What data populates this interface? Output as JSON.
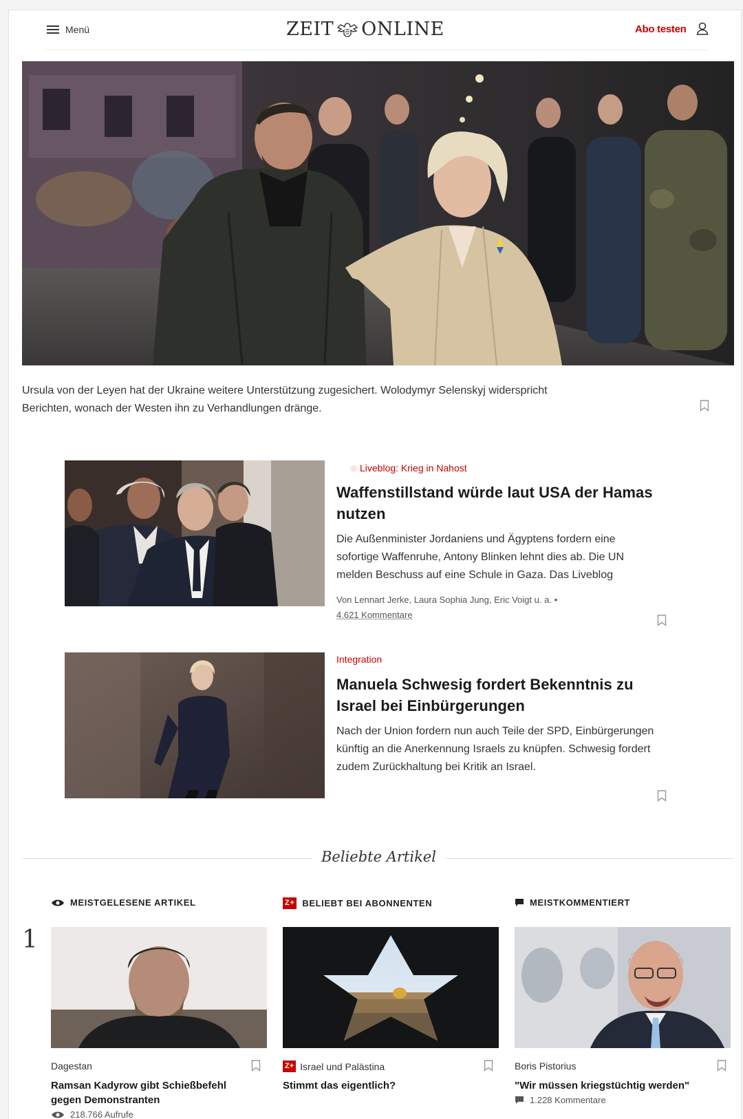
{
  "header": {
    "menu_label": "Menü",
    "logo_left": "ZEIT",
    "logo_right": "ONLINE",
    "abo_label": "Abo testen"
  },
  "hero": {
    "caption": "Ursula von der Leyen hat der Ukraine weitere Unterstützung zugesichert. Wolodymyr Selenskyj widerspricht Berichten, wonach der Westen ihn zu Verhandlungen dränge."
  },
  "articles": [
    {
      "kicker": "Liveblog: Krieg in Nahost",
      "title": "Waffenstillstand würde laut USA der Hamas nutzen",
      "teaser": "Die Außenminister Jordaniens und Ägyptens fordern eine sofortige Waffenruhe, Antony Blinken lehnt dies ab. Die UN melden Beschuss auf eine Schule in Gaza. Das Liveblog",
      "authors": "Von Lennart Jerke, Laura Sophia Jung, Eric Voigt u. a.",
      "comments": "4.621 Kommentare"
    },
    {
      "kicker": "Integration",
      "title": "Manuela Schwesig fordert Bekenntnis zu Israel bei Einbürgerungen",
      "teaser": "Nach der Union fordern nun auch Teile der SPD, Einbürgerungen künftig an die Anerkennung Israels zu knüpfen. Schwesig fordert zudem Zurückhaltung bei Kritik an Israel."
    }
  ],
  "popular": {
    "section_title": "Beliebte Artikel",
    "rank": "1",
    "columns": [
      {
        "heading": "MEISTGELESENE ARTIKEL",
        "kicker": "Dagestan",
        "title": "Ramsan Kadyrow gibt Schießbefehl gegen Demonstranten",
        "meta": "218.766 Aufrufe"
      },
      {
        "heading": "BELIEBT BEI ABONNENTEN",
        "badge": "Z+",
        "kicker": "Israel und Palästina",
        "title": "Stimmt das eigentlich?"
      },
      {
        "heading": "MEISTKOMMENTIERT",
        "kicker": "Boris Pistorius",
        "title": "\"Wir müssen kriegstüchtig werden\"",
        "meta": "1.228 Kommentare"
      }
    ]
  },
  "colors": {
    "accent": "#c80000",
    "text": "#252525"
  }
}
